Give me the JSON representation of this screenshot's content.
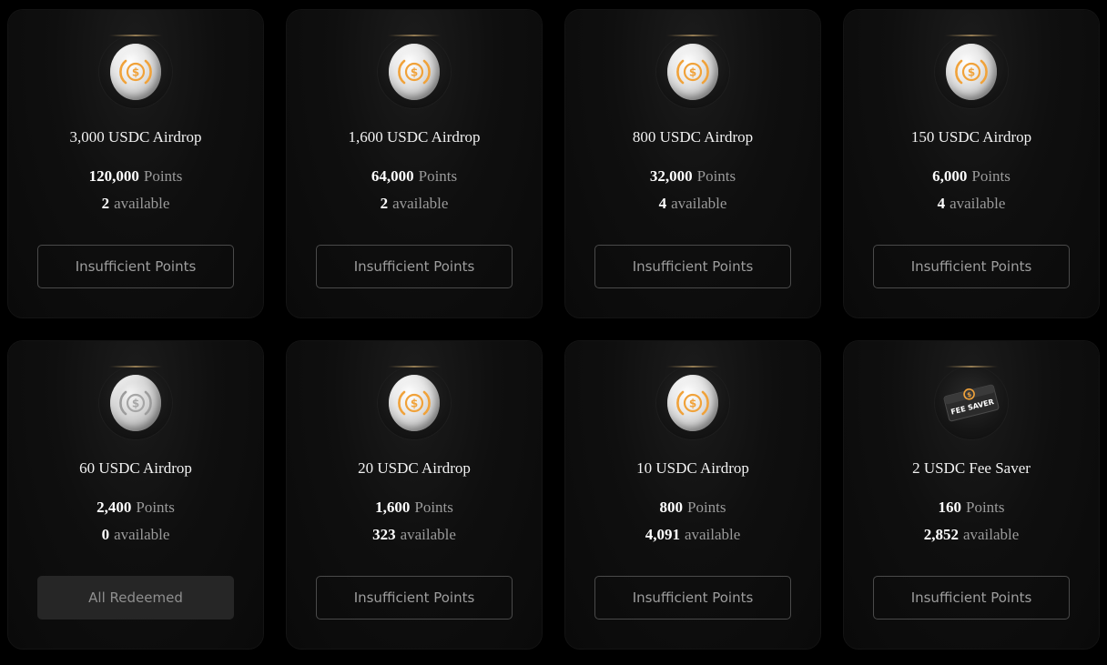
{
  "colors": {
    "background": "#000000",
    "card": "#0f0f0f",
    "coin_accent": "#f0a23a",
    "button_border": "#4a4a4a",
    "redeemed_button_bg": "#262626"
  },
  "cards": [
    {
      "title": "3,000 USDC Airdrop",
      "points": "120,000",
      "points_label": "Points",
      "available": "2",
      "available_label": "available",
      "button": "Insufficient Points",
      "icon": "usdc-coin-icon"
    },
    {
      "title": "1,600 USDC Airdrop",
      "points": "64,000",
      "points_label": "Points",
      "available": "2",
      "available_label": "available",
      "button": "Insufficient Points",
      "icon": "usdc-coin-icon"
    },
    {
      "title": "800 USDC Airdrop",
      "points": "32,000",
      "points_label": "Points",
      "available": "4",
      "available_label": "available",
      "button": "Insufficient Points",
      "icon": "usdc-coin-icon"
    },
    {
      "title": "150 USDC Airdrop",
      "points": "6,000",
      "points_label": "Points",
      "available": "4",
      "available_label": "available",
      "button": "Insufficient Points",
      "icon": "usdc-coin-icon"
    },
    {
      "title": "60 USDC Airdrop",
      "points": "2,400",
      "points_label": "Points",
      "available": "0",
      "available_label": "available",
      "button": "All Redeemed",
      "icon": "usdc-coin-gray-icon"
    },
    {
      "title": "20 USDC Airdrop",
      "points": "1,600",
      "points_label": "Points",
      "available": "323",
      "available_label": "available",
      "button": "Insufficient Points",
      "icon": "usdc-coin-icon"
    },
    {
      "title": "10 USDC Airdrop",
      "points": "800",
      "points_label": "Points",
      "available": "4,091",
      "available_label": "available",
      "button": "Insufficient Points",
      "icon": "usdc-coin-icon"
    },
    {
      "title": "2 USDC Fee Saver",
      "points": "160",
      "points_label": "Points",
      "available": "2,852",
      "available_label": "available",
      "button": "Insufficient Points",
      "icon": "fee-saver-ticket-icon",
      "ticket_text": "FEE SAVER"
    }
  ]
}
